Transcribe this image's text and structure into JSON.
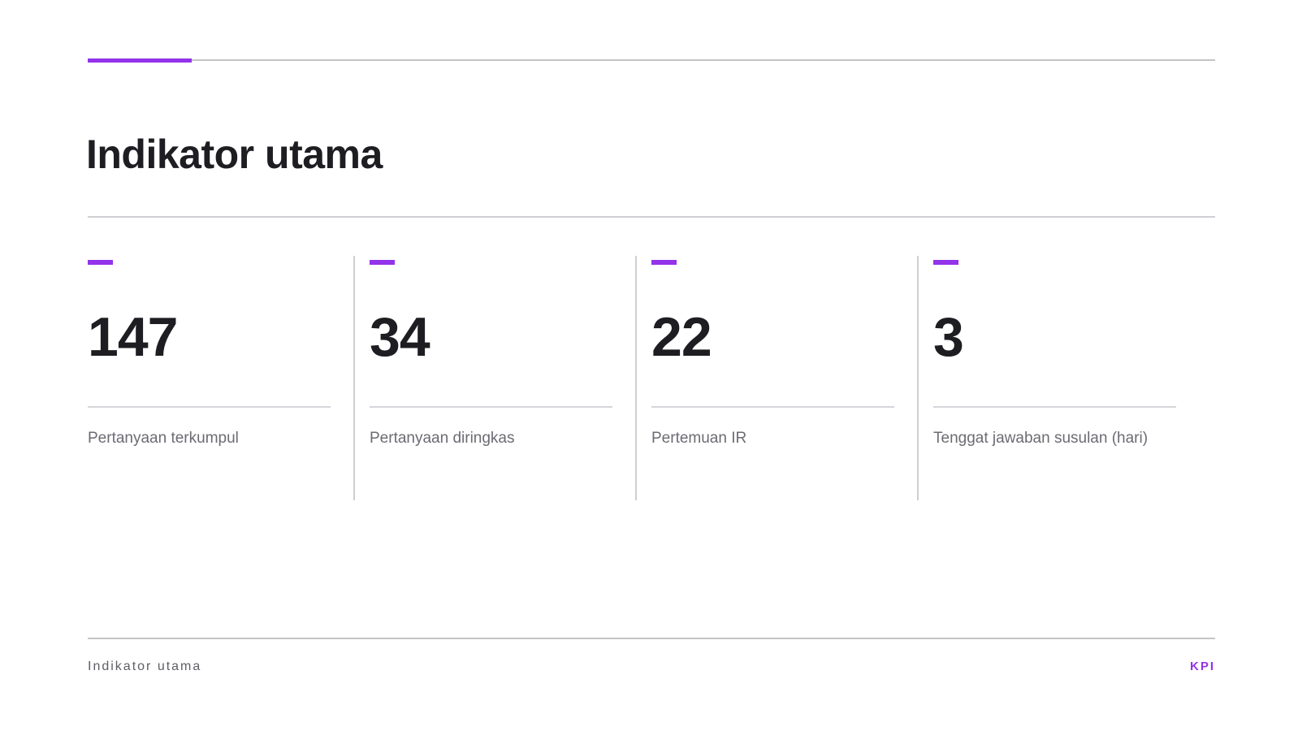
{
  "header": {
    "title": "Indikator utama"
  },
  "kpis": [
    {
      "value": "147",
      "label": "Pertanyaan terkumpul"
    },
    {
      "value": "34",
      "label": "Pertanyaan diringkas"
    },
    {
      "value": "22",
      "label": "Pertemuan IR"
    },
    {
      "value": "3",
      "label": "Tenggat jawaban susulan (hari)"
    }
  ],
  "footer": {
    "section": "Indikator utama",
    "tag": "KPI"
  },
  "colors": {
    "accent": "#9333ea",
    "text": "#1d1d22",
    "muted": "#6b6b73",
    "rule": "#c4c4c8"
  }
}
